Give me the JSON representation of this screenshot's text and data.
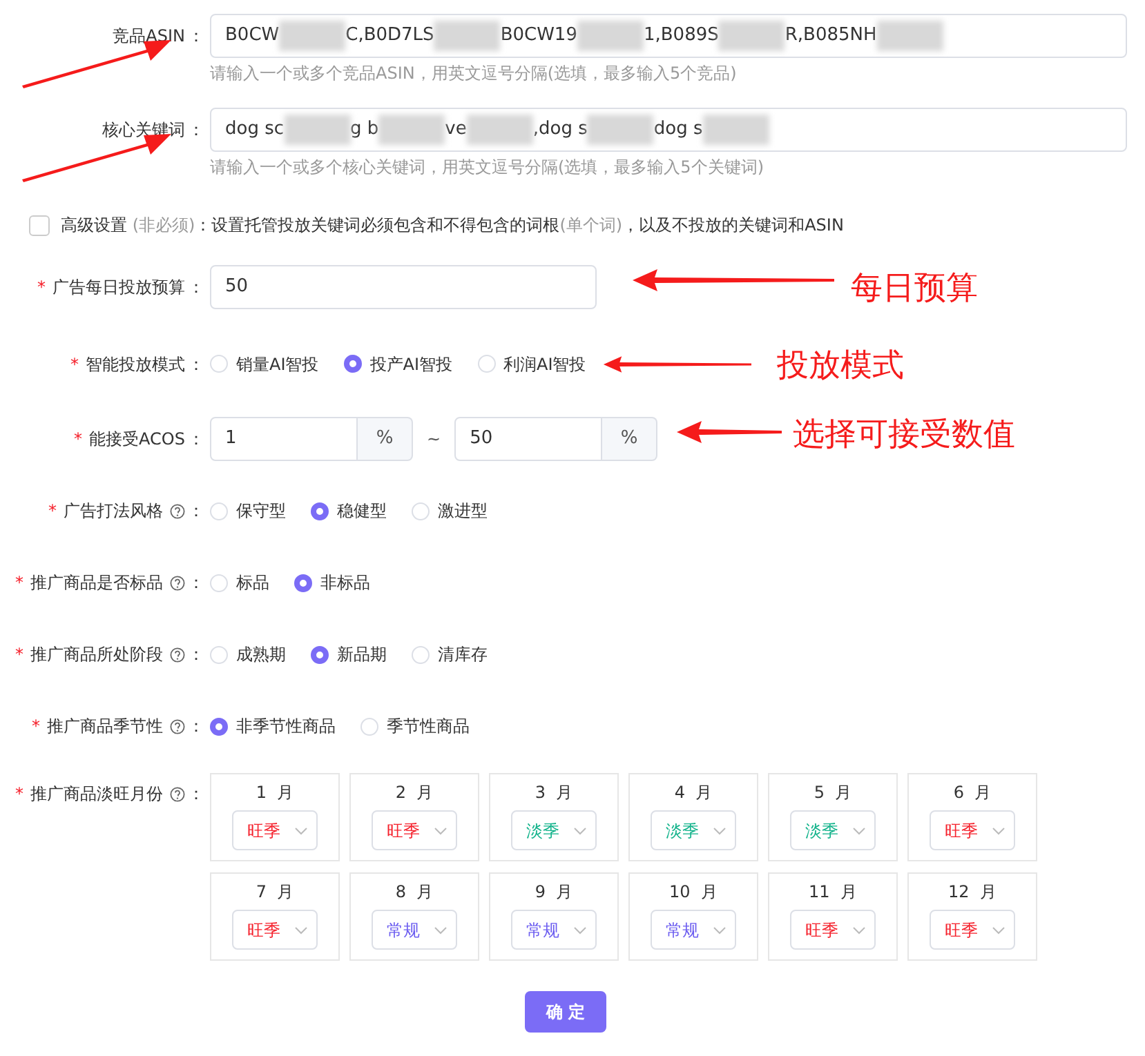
{
  "asin_field": {
    "label": "竞品ASIN",
    "colon": "：",
    "arrow": true,
    "value_parts": [
      {
        "kind": "text",
        "text": "B0CW"
      },
      {
        "kind": "redacted"
      },
      {
        "kind": "text",
        "text": "C,B0D7LS"
      },
      {
        "kind": "redacted"
      },
      {
        "kind": "text",
        "text": "B0CW19"
      },
      {
        "kind": "redacted"
      },
      {
        "kind": "text",
        "text": "1,B089S"
      },
      {
        "kind": "redacted"
      },
      {
        "kind": "text",
        "text": "R,B085NH"
      },
      {
        "kind": "redacted"
      }
    ],
    "hint": "请输入一个或多个竞品ASIN，用英文逗号分隔(选填，最多输入5个竞品)"
  },
  "keyword_field": {
    "label": "核心关键词",
    "colon": "：",
    "arrow": true,
    "value_parts": [
      {
        "kind": "text",
        "text": "dog sc"
      },
      {
        "kind": "redacted"
      },
      {
        "kind": "text",
        "text": "g b"
      },
      {
        "kind": "redacted"
      },
      {
        "kind": "text",
        "text": "ve"
      },
      {
        "kind": "redacted"
      },
      {
        "kind": "text",
        "text": ",dog s"
      },
      {
        "kind": "redacted"
      },
      {
        "kind": "text",
        "text": "dog s"
      },
      {
        "kind": "redacted"
      }
    ],
    "hint": "请输入一个或多个核心关键词，用英文逗号分隔(选填，最多输入5个关键词)"
  },
  "advanced": {
    "checked": false,
    "label": "高级设置",
    "optional": "(非必须)",
    "desc_parts": [
      {
        "kind": "text",
        "text": "：设置托管投放关键词必须包含和不得包含的词根"
      },
      {
        "kind": "muted",
        "text": "(单个词)"
      },
      {
        "kind": "text",
        "text": "，以及不投放的关键词和ASIN"
      }
    ]
  },
  "budget": {
    "label": "广告每日投放预算",
    "required_mark": "*",
    "colon": "：",
    "value": "50",
    "annotation": "每日预算"
  },
  "mode": {
    "label": "智能投放模式",
    "required_mark": "*",
    "colon": "：",
    "annotation": "投放模式",
    "options": [
      {
        "label": "销量AI智投",
        "selected": false
      },
      {
        "label": "投产AI智投",
        "selected": true
      },
      {
        "label": "利润AI智投",
        "selected": false
      }
    ]
  },
  "acos": {
    "label": "能接受ACOS",
    "required_mark": "*",
    "colon": "：",
    "min": "1",
    "unit_min": "%",
    "sep": "~",
    "max": "50",
    "unit_max": "%",
    "annotation": "选择可接受数值"
  },
  "radio_groups": [
    {
      "label": "广告打法风格",
      "required_mark": "*",
      "help": true,
      "colon": "：",
      "options": [
        {
          "label": "保守型",
          "selected": false
        },
        {
          "label": "稳健型",
          "selected": true
        },
        {
          "label": "激进型",
          "selected": false
        }
      ]
    },
    {
      "label": "推广商品是否标品",
      "required_mark": "*",
      "help": true,
      "colon": "：",
      "options": [
        {
          "label": "标品",
          "selected": false
        },
        {
          "label": "非标品",
          "selected": true
        }
      ]
    },
    {
      "label": "推广商品所处阶段",
      "required_mark": "*",
      "help": true,
      "colon": "：",
      "options": [
        {
          "label": "成熟期",
          "selected": false
        },
        {
          "label": "新品期",
          "selected": true
        },
        {
          "label": "清库存",
          "selected": false
        }
      ]
    },
    {
      "label": "推广商品季节性",
      "required_mark": "*",
      "help": true,
      "colon": "：",
      "options": [
        {
          "label": "非季节性商品",
          "selected": true
        },
        {
          "label": "季节性商品",
          "selected": false
        }
      ]
    }
  ],
  "months": {
    "label": "推广商品淡旺月份",
    "required_mark": "*",
    "help": true,
    "colon": "：",
    "items": [
      {
        "month": "1",
        "unit": "月",
        "value": "旺季",
        "kind": "peak"
      },
      {
        "month": "2",
        "unit": "月",
        "value": "旺季",
        "kind": "peak"
      },
      {
        "month": "3",
        "unit": "月",
        "value": "淡季",
        "kind": "off"
      },
      {
        "month": "4",
        "unit": "月",
        "value": "淡季",
        "kind": "off"
      },
      {
        "month": "5",
        "unit": "月",
        "value": "淡季",
        "kind": "off"
      },
      {
        "month": "6",
        "unit": "月",
        "value": "旺季",
        "kind": "peak"
      },
      {
        "month": "7",
        "unit": "月",
        "value": "旺季",
        "kind": "peak"
      },
      {
        "month": "8",
        "unit": "月",
        "value": "常规",
        "kind": "normal"
      },
      {
        "month": "9",
        "unit": "月",
        "value": "常规",
        "kind": "normal"
      },
      {
        "month": "10",
        "unit": "月",
        "value": "常规",
        "kind": "normal"
      },
      {
        "month": "11",
        "unit": "月",
        "value": "旺季",
        "kind": "peak"
      },
      {
        "month": "12",
        "unit": "月",
        "value": "旺季",
        "kind": "peak"
      }
    ]
  },
  "submit": "确 定"
}
